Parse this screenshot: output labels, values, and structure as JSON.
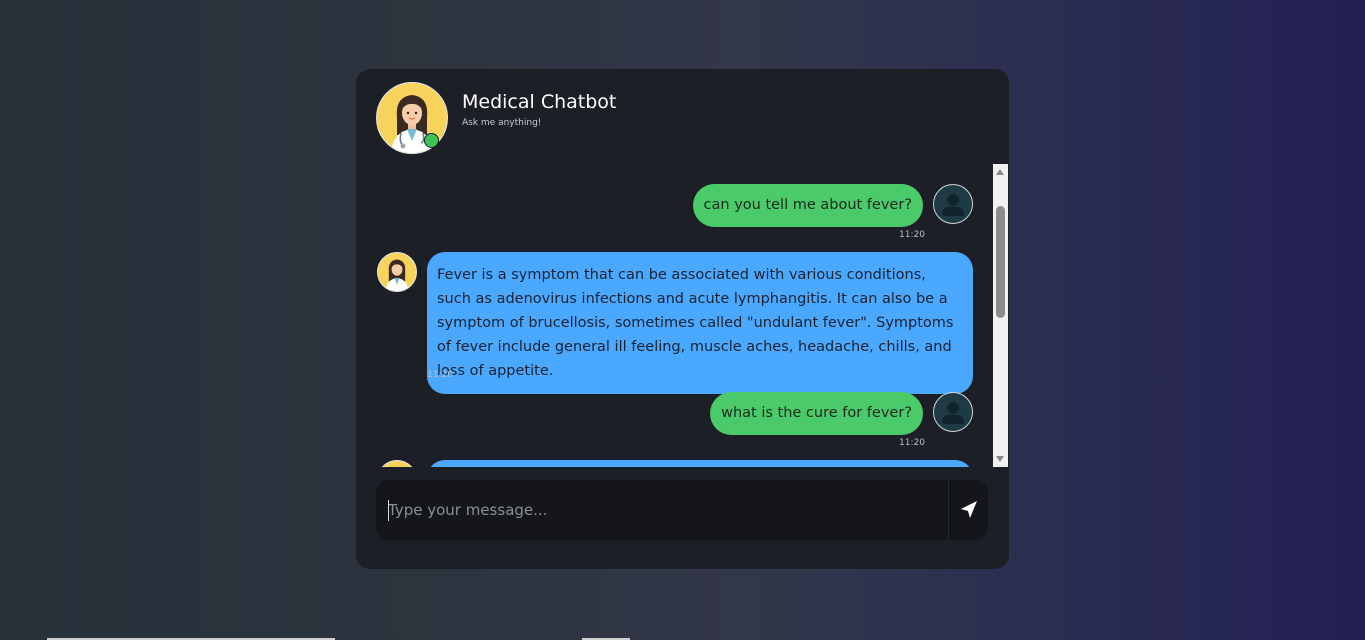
{
  "header": {
    "title": "Medical Chatbot",
    "subtitle": "Ask me anything!",
    "online_status_color": "#3cc457"
  },
  "messages": [
    {
      "sender": "user",
      "text": "can you tell me about fever?",
      "time": "11:20"
    },
    {
      "sender": "bot",
      "text": "Fever is a symptom that can be associated with various conditions, such as adenovirus infections and acute lymphangitis. It can also be a symptom of brucellosis, sometimes called \"undulant fever\". Symptoms of fever include general ill feeling, muscle aches, headache, chills, and loss of appetite.",
      "time": "11:20"
    },
    {
      "sender": "user",
      "text": "what is the cure for fever?",
      "time": "11:20"
    }
  ],
  "input": {
    "placeholder": "Type your message..."
  },
  "icons": {
    "send": "send-icon",
    "user_avatar": "user-avatar-icon",
    "bot_avatar": "doctor-avatar-icon"
  },
  "colors": {
    "user_bubble": "#4bca6a",
    "bot_bubble": "#4aa8ff",
    "card_bg": "#1c1f26"
  }
}
